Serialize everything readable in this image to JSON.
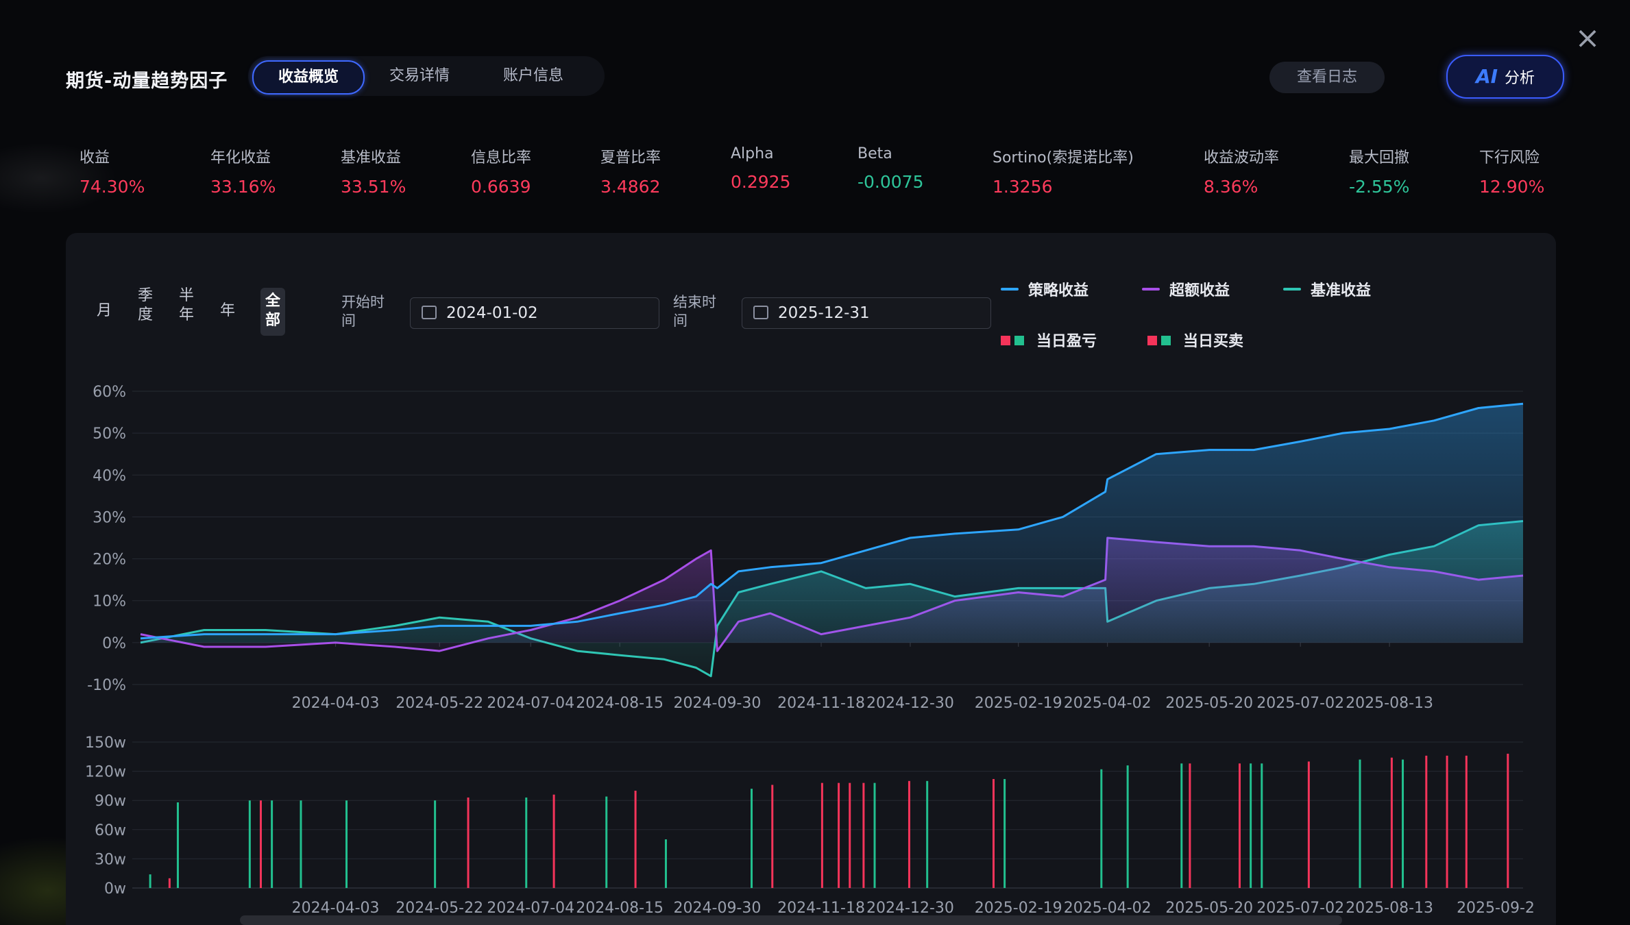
{
  "title": "期货-动量趋势因子",
  "tabs": [
    {
      "label": "收益概览"
    },
    {
      "label": "交易详情"
    },
    {
      "label": "账户信息"
    }
  ],
  "buttons": {
    "log": "查看日志",
    "ai_mark": "AI",
    "ai_label": "分析",
    "close": "×"
  },
  "metrics": [
    {
      "label": "收益",
      "value": "74.30%",
      "color": "#ff3b5c"
    },
    {
      "label": "年化收益",
      "value": "33.16%",
      "color": "#ff3b5c"
    },
    {
      "label": "基准收益",
      "value": "33.51%",
      "color": "#ff3b5c"
    },
    {
      "label": "信息比率",
      "value": "0.6639",
      "color": "#ff3b5c"
    },
    {
      "label": "夏普比率",
      "value": "3.4862",
      "color": "#ff3b5c"
    },
    {
      "label": "Alpha",
      "value": "0.2925",
      "color": "#ff3b5c"
    },
    {
      "label": "Beta",
      "value": "-0.0075",
      "color": "#2ec59a"
    },
    {
      "label": "Sortino(索提诺比率)",
      "value": "1.3256",
      "color": "#ff3b5c"
    },
    {
      "label": "收益波动率",
      "value": "8.36%",
      "color": "#ff3b5c"
    },
    {
      "label": "最大回撤",
      "value": "-2.55%",
      "color": "#2ec59a"
    },
    {
      "label": "下行风险",
      "value": "12.90%",
      "color": "#ff3b5c"
    }
  ],
  "periods": [
    {
      "label": "月"
    },
    {
      "label": "季度"
    },
    {
      "label": "半年"
    },
    {
      "label": "年"
    },
    {
      "label": "全部"
    }
  ],
  "date_filter": {
    "start_label": "开始时间",
    "start_value": "2024-01-02",
    "end_label": "结束时间",
    "end_value": "2025-12-31"
  },
  "legend": {
    "strategy": "策略收益",
    "excess": "超额收益",
    "benchmark": "基准收益",
    "daily_pnl": "当日盈亏",
    "daily_trade": "当日买卖"
  },
  "colors": {
    "strategy": "#2ea6ff",
    "excess": "#a84fe8",
    "benchmark": "#2fc6b4",
    "up": "#f5345a",
    "down": "#22c08f"
  },
  "chart_data": [
    {
      "type": "line",
      "x_ticks": [
        "2024-04-03",
        "2024-05-22",
        "2024-07-04",
        "2024-08-15",
        "2024-09-30",
        "2024-11-18",
        "2024-12-30",
        "2025-02-19",
        "2025-04-02",
        "2025-05-20",
        "2025-07-02",
        "2025-08-13"
      ],
      "y_ticks": [
        "60%",
        "50%",
        "40%",
        "30%",
        "20%",
        "10%",
        "0%",
        "-10%"
      ],
      "ylim": [
        -10,
        60
      ],
      "x": [
        "2024-01-02",
        "2024-02-01",
        "2024-03-01",
        "2024-04-03",
        "2024-05-01",
        "2024-05-22",
        "2024-06-14",
        "2024-07-04",
        "2024-07-26",
        "2024-08-15",
        "2024-09-05",
        "2024-09-20",
        "2024-09-27",
        "2024-09-30",
        "2024-10-10",
        "2024-10-25",
        "2024-11-18",
        "2024-12-09",
        "2024-12-30",
        "2025-01-20",
        "2025-02-19",
        "2025-03-12",
        "2025-04-01",
        "2025-04-02",
        "2025-04-25",
        "2025-05-20",
        "2025-06-10",
        "2025-07-02",
        "2025-07-22",
        "2025-08-13",
        "2025-09-03",
        "2025-09-24",
        "2025-10-15"
      ],
      "series": [
        {
          "name": "策略收益",
          "values": [
            1,
            2,
            2,
            2,
            3,
            4,
            4,
            4,
            5,
            7,
            9,
            11,
            14,
            13,
            17,
            18,
            19,
            22,
            25,
            26,
            27,
            30,
            36,
            39,
            45,
            46,
            46,
            48,
            50,
            51,
            53,
            56,
            57
          ]
        },
        {
          "name": "超额收益",
          "values": [
            2,
            -1,
            -1,
            0,
            -1,
            -2,
            1,
            3,
            6,
            10,
            15,
            20,
            22,
            -2,
            5,
            7,
            2,
            4,
            6,
            10,
            12,
            11,
            15,
            25,
            24,
            23,
            23,
            22,
            20,
            18,
            17,
            15,
            16
          ]
        },
        {
          "name": "基准收益",
          "values": [
            0,
            3,
            3,
            2,
            4,
            6,
            5,
            1,
            -2,
            -3,
            -4,
            -6,
            -8,
            4,
            12,
            14,
            17,
            13,
            14,
            11,
            13,
            13,
            13,
            5,
            10,
            13,
            14,
            16,
            18,
            21,
            23,
            28,
            29
          ]
        }
      ]
    },
    {
      "type": "bar",
      "y_ticks": [
        "150w",
        "120w",
        "90w",
        "60w",
        "30w",
        "0w"
      ],
      "ylim": [
        0,
        150
      ],
      "x_ticks": [
        "2024-04-03",
        "2024-05-22",
        "2024-07-04",
        "2024-08-15",
        "2024-09-30",
        "2024-11-18",
        "2024-12-30",
        "2025-02-19",
        "2025-04-02",
        "2025-05-20",
        "2025-07-02",
        "2025-08-13",
        "2025-09-2"
      ],
      "bars": [
        {
          "t": 0.007,
          "v": 14,
          "up": false
        },
        {
          "t": 0.021,
          "v": 10,
          "up": true
        },
        {
          "t": 0.027,
          "v": 88,
          "up": false
        },
        {
          "t": 0.079,
          "v": 90,
          "up": false
        },
        {
          "t": 0.087,
          "v": 90,
          "up": true
        },
        {
          "t": 0.095,
          "v": 90,
          "up": false
        },
        {
          "t": 0.116,
          "v": 90,
          "up": false
        },
        {
          "t": 0.149,
          "v": 90,
          "up": false
        },
        {
          "t": 0.213,
          "v": 90,
          "up": false
        },
        {
          "t": 0.237,
          "v": 93,
          "up": true
        },
        {
          "t": 0.279,
          "v": 93,
          "up": false
        },
        {
          "t": 0.299,
          "v": 96,
          "up": true
        },
        {
          "t": 0.337,
          "v": 94,
          "up": false
        },
        {
          "t": 0.358,
          "v": 100,
          "up": true
        },
        {
          "t": 0.38,
          "v": 50,
          "up": false
        },
        {
          "t": 0.442,
          "v": 102,
          "up": false
        },
        {
          "t": 0.457,
          "v": 106,
          "up": true
        },
        {
          "t": 0.493,
          "v": 108,
          "up": true
        },
        {
          "t": 0.505,
          "v": 108,
          "up": true
        },
        {
          "t": 0.513,
          "v": 108,
          "up": true
        },
        {
          "t": 0.523,
          "v": 108,
          "up": true
        },
        {
          "t": 0.531,
          "v": 108,
          "up": false
        },
        {
          "t": 0.556,
          "v": 110,
          "up": true
        },
        {
          "t": 0.569,
          "v": 110,
          "up": false
        },
        {
          "t": 0.617,
          "v": 112,
          "up": true
        },
        {
          "t": 0.625,
          "v": 112,
          "up": false
        },
        {
          "t": 0.695,
          "v": 122,
          "up": false
        },
        {
          "t": 0.714,
          "v": 126,
          "up": false
        },
        {
          "t": 0.753,
          "v": 128,
          "up": false
        },
        {
          "t": 0.759,
          "v": 128,
          "up": true
        },
        {
          "t": 0.795,
          "v": 128,
          "up": true
        },
        {
          "t": 0.803,
          "v": 128,
          "up": false
        },
        {
          "t": 0.811,
          "v": 128,
          "up": false
        },
        {
          "t": 0.845,
          "v": 130,
          "up": true
        },
        {
          "t": 0.882,
          "v": 132,
          "up": false
        },
        {
          "t": 0.905,
          "v": 134,
          "up": true
        },
        {
          "t": 0.913,
          "v": 132,
          "up": false
        },
        {
          "t": 0.93,
          "v": 136,
          "up": true
        },
        {
          "t": 0.945,
          "v": 136,
          "up": true
        },
        {
          "t": 0.959,
          "v": 136,
          "up": true
        },
        {
          "t": 0.989,
          "v": 138,
          "up": true
        }
      ]
    }
  ]
}
